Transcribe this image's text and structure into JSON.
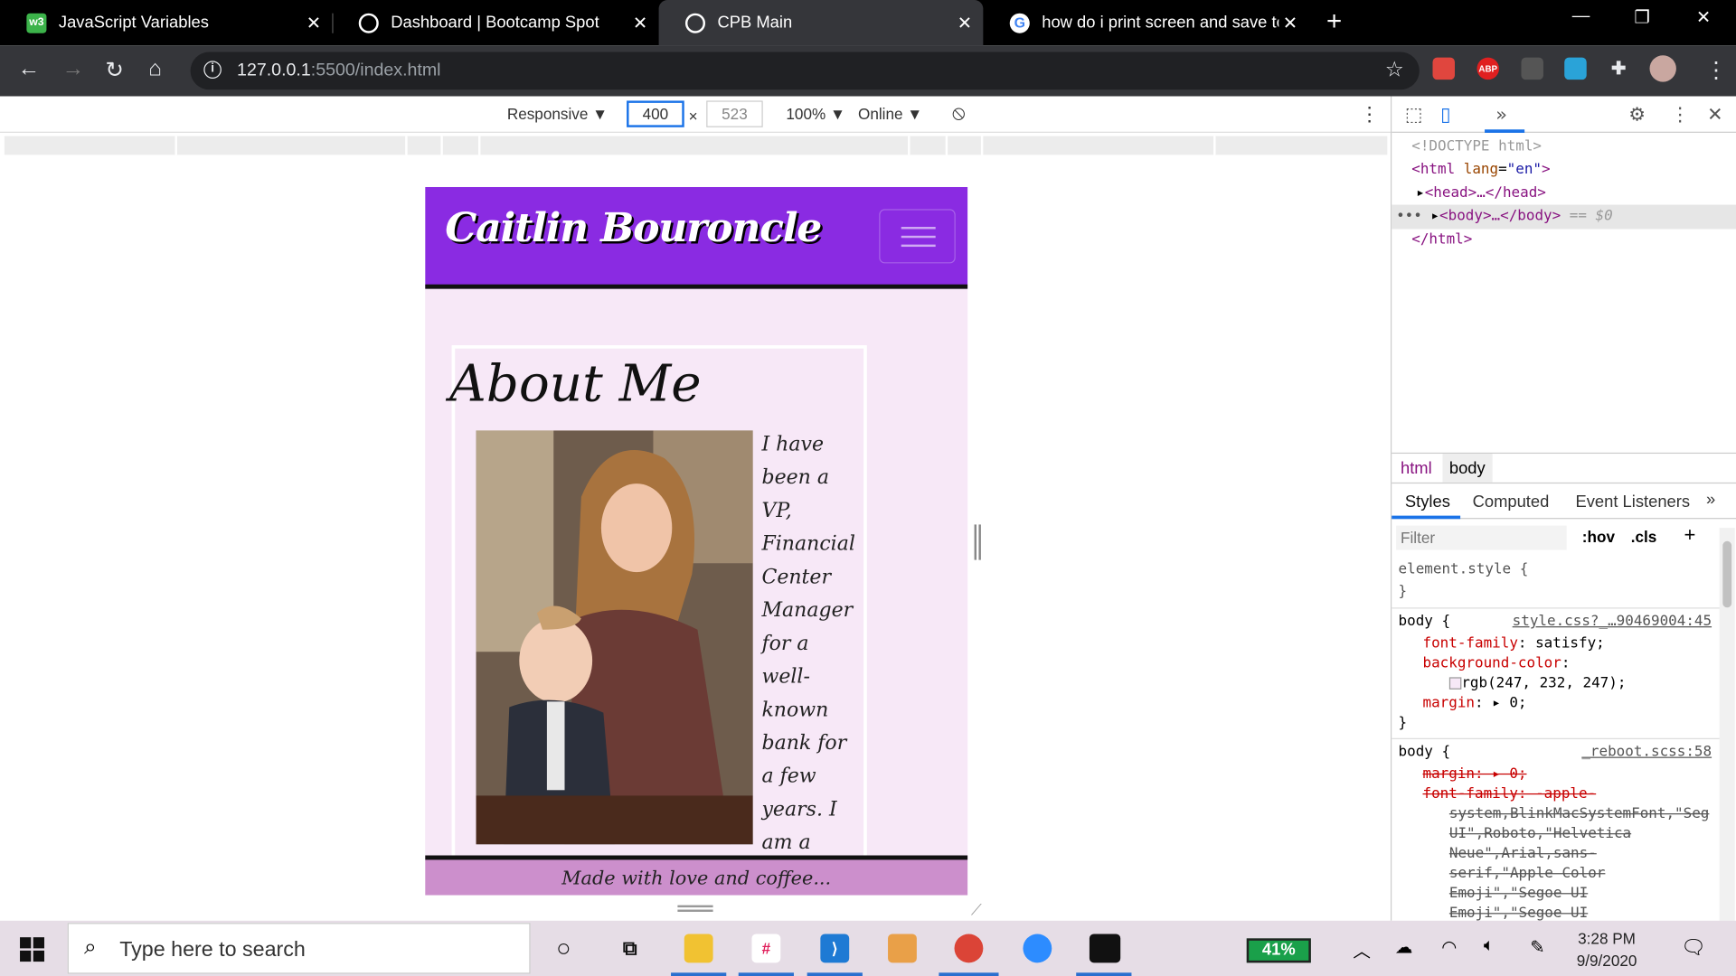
{
  "tabs": [
    {
      "title": "JavaScript Variables",
      "fav_color": "#3cb34a",
      "fav_text": "w3"
    },
    {
      "title": "Dashboard | Bootcamp Spot",
      "fav_color": "#ffffff",
      "fav_text": ""
    },
    {
      "title": "CPB Main",
      "fav_color": "#ffffff",
      "fav_text": ""
    },
    {
      "title": "how do i print screen and save to",
      "fav_color": "#ffffff",
      "fav_text": "G"
    }
  ],
  "address": {
    "host": "127.0.0.1",
    "rest": ":5500/index.html"
  },
  "extensions": {
    "abp": "ABP"
  },
  "device_toolbar": {
    "mode": "Responsive",
    "width": "400",
    "height": "523",
    "times": "×",
    "zoom": "100%",
    "network": "Online"
  },
  "site": {
    "brand": "Caitlin Bouroncle",
    "about_title": "About Me",
    "about_text": "I have been a VP, Financial Center Manager for a well-known bank for a few years. I am a",
    "footer": "Made with love and coffee..."
  },
  "devtools": {
    "dom": {
      "doctype": "<!DOCTYPE html>",
      "html_open_tag": "<html",
      "lang_attr": "lang",
      "lang_val": "\"en\"",
      "gt": ">",
      "head": "<head>…</head>",
      "body": "<body>…</body>",
      "body_suffix": "== $0",
      "html_close": "</html>"
    },
    "breadcrumbs": [
      "html",
      "body"
    ],
    "panel_tabs": [
      "Styles",
      "Computed",
      "Event Listeners"
    ],
    "filter_placeholder": "Filter",
    "hov": ":hov",
    "cls": ".cls",
    "rules": {
      "element_style": "element.style {",
      "close": "}",
      "body_sel": "body {",
      "body_src": "style.css?_…90469004:45",
      "ff_prop": "font-family",
      "ff_val": ": satisfy;",
      "bg_prop": "background-color",
      "bg_val": "rgb(247, 232, 247);",
      "margin_prop": "margin",
      "margin_val": ": ▸ 0;",
      "reboot_sel": "body {",
      "reboot_src": "_reboot.scss:58",
      "r_margin": "margin: ▸ 0;",
      "r_ff1": "font-family: -apple-",
      "r_ff2": "system,BlinkMacSystemFont,\"Seg",
      "r_ff3": "UI\",Roboto,\"Helvetica",
      "r_ff4": "Neue\",Arial,sans-",
      "r_ff5": "serif,\"Apple Color",
      "r_ff6": "Emoji\",\"Segoe UI",
      "r_ff7": "Emoji\",\"Segoe UI"
    }
  },
  "taskbar": {
    "search_placeholder": "Type here to search",
    "battery": "41%",
    "time": "3:28 PM",
    "date": "9/9/2020"
  },
  "colors": {
    "site_nav": "#8a2be2",
    "site_bg": "#f7e8f7",
    "site_footer": "#cc8fcc"
  }
}
